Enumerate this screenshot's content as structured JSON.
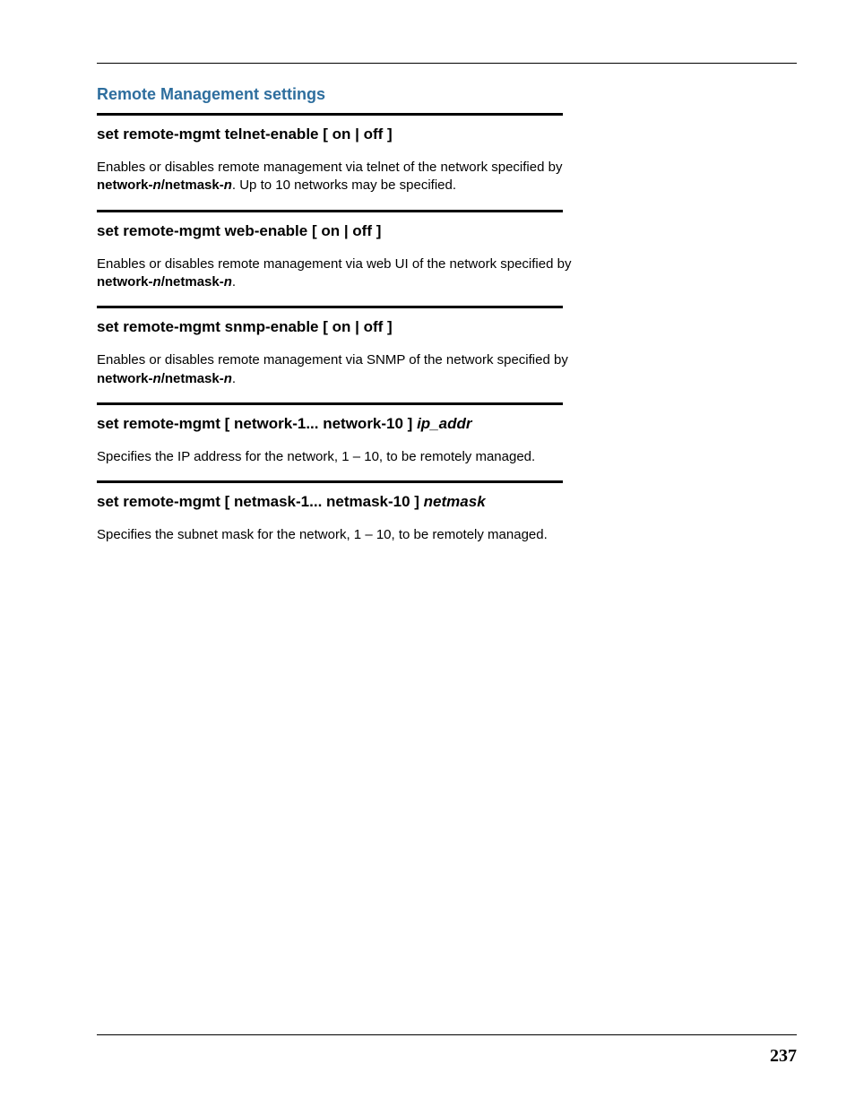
{
  "page": {
    "title": "Remote Management settings",
    "number": "237"
  },
  "sections": {
    "s1": {
      "heading": "set remote-mgmt telnet-enable [ on | off ]",
      "d_a": "Enables or disables remote management via telnet of the network specified by ",
      "d_b": "network-",
      "d_c": "n",
      "d_d": "/",
      "d_e": "netmask-",
      "d_f": "n",
      "d_g": ". Up to 10 networks may be specified."
    },
    "s2": {
      "heading": "set remote-mgmt web-enable [ on | off ]",
      "d_a": "Enables or disables remote management via web UI of the network specified by ",
      "d_b": "network-",
      "d_c": "n",
      "d_d": "/",
      "d_e": "netmask-",
      "d_f": "n",
      "d_g": "."
    },
    "s3": {
      "heading": "set remote-mgmt snmp-enable [ on | off ]",
      "d_a": "Enables or disables remote management via SNMP of the network specified by ",
      "d_b": "network-",
      "d_c": "n",
      "d_d": "/",
      "d_e": "netmask-",
      "d_f": "n",
      "d_g": "."
    },
    "s4": {
      "h_a": "set remote-mgmt [ network-1... network-10 ] ",
      "h_b": "ip_addr",
      "desc": "Specifies the IP address for the network, 1 – 10, to be remotely managed."
    },
    "s5": {
      "h_a": "set remote-mgmt [ netmask-1... netmask-10 ] ",
      "h_b": "netmask",
      "desc": "Specifies the subnet mask for the network, 1 – 10, to be remotely managed."
    }
  }
}
